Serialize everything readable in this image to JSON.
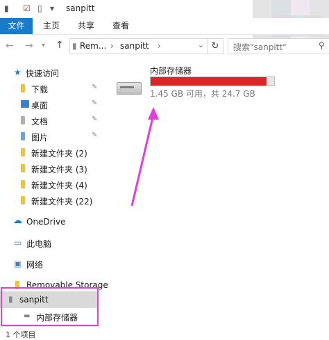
{
  "window": {
    "title": "sanpitt"
  },
  "ribbon": {
    "tabs": [
      "文件",
      "主页",
      "共享",
      "查看"
    ]
  },
  "address": {
    "segments": [
      "Rem...",
      "sanpitt"
    ],
    "search_placeholder": "搜索\"sanpitt\""
  },
  "nav": {
    "quick_access": "快速访问",
    "items": [
      {
        "label": "下载",
        "pinned": true
      },
      {
        "label": "桌面",
        "pinned": true
      },
      {
        "label": "文档",
        "pinned": true
      },
      {
        "label": "图片",
        "pinned": true
      },
      {
        "label": "新建文件夹 (2)",
        "pinned": false
      },
      {
        "label": "新建文件夹 (3)",
        "pinned": false
      },
      {
        "label": "新建文件夹 (4)",
        "pinned": false
      },
      {
        "label": "新建文件夹 (22)",
        "pinned": false
      }
    ],
    "onedrive": "OneDrive",
    "this_pc": "此电脑",
    "network": "网络",
    "removable": "Removable Storage",
    "sanpitt": "sanpitt",
    "internal": "内部存储器"
  },
  "drive": {
    "name": "内部存储器",
    "info": "1.45 GB 可用，共 24.7 GB",
    "used_fraction": 0.94
  },
  "status": {
    "text": "1 个项目"
  },
  "colors": {
    "accent": "#1979ca",
    "bar_fill": "#da2626",
    "highlight": "#e43cdf"
  }
}
